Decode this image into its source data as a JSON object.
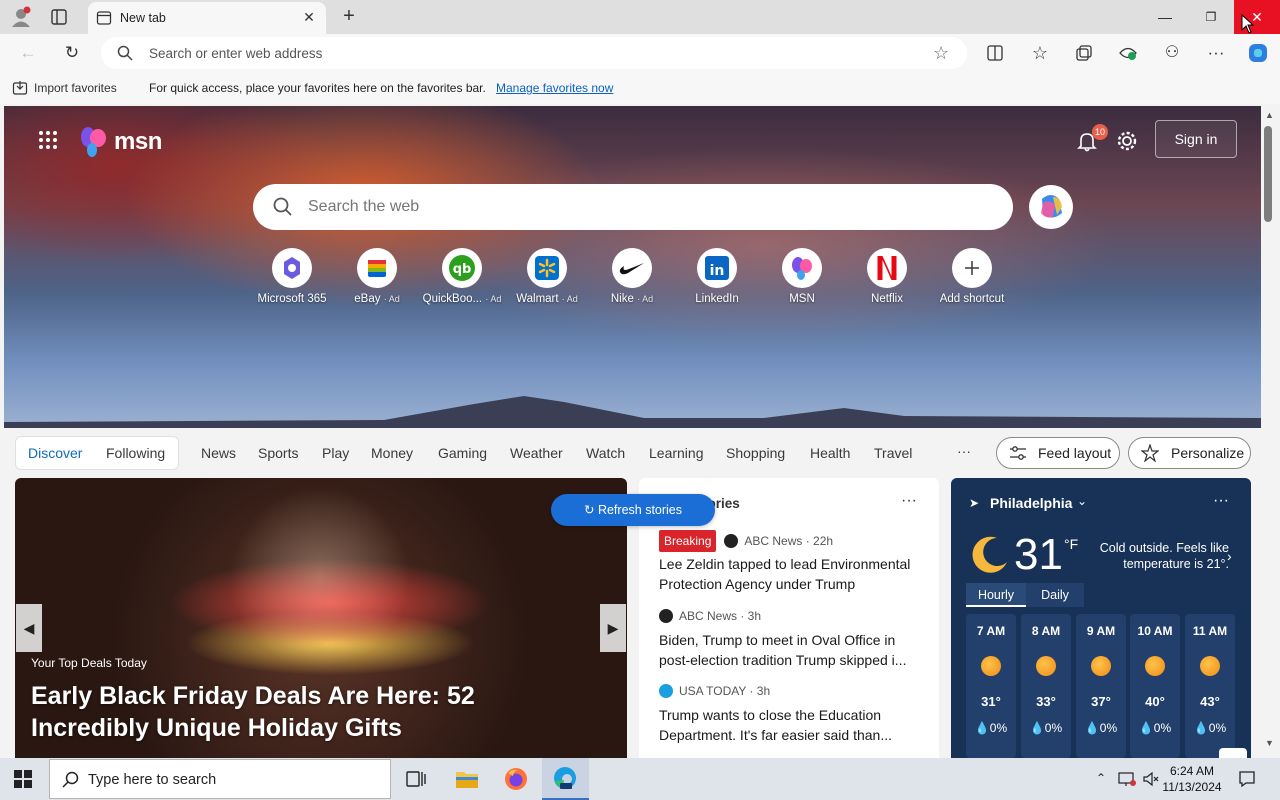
{
  "browser": {
    "tab_title": "New tab",
    "address_placeholder": "Search or enter web address",
    "favorites": {
      "import_label": "Import favorites",
      "message": "For quick access, place your favorites here on the favorites bar.",
      "manage_link": "Manage favorites now"
    }
  },
  "msn": {
    "logo_text": "msn",
    "notification_count": "10",
    "sign_in": "Sign in",
    "search_placeholder": "Search the web",
    "shortcuts": [
      {
        "label": "Microsoft 365",
        "ad": "",
        "icon": "microsoft365-icon"
      },
      {
        "label": "eBay",
        "ad": "· Ad",
        "icon": "ebay-icon"
      },
      {
        "label": "QuickBoo...",
        "ad": "· Ad",
        "icon": "quickbooks-icon"
      },
      {
        "label": "Walmart",
        "ad": "· Ad",
        "icon": "walmart-icon"
      },
      {
        "label": "Nike",
        "ad": "· Ad",
        "icon": "nike-icon"
      },
      {
        "label": "LinkedIn",
        "ad": "",
        "icon": "linkedin-icon"
      },
      {
        "label": "MSN",
        "ad": "",
        "icon": "msn-icon"
      },
      {
        "label": "Netflix",
        "ad": "",
        "icon": "netflix-icon"
      },
      {
        "label": "Add shortcut",
        "ad": "",
        "icon": "plus-icon"
      }
    ]
  },
  "feed_nav": {
    "discover": "Discover",
    "following": "Following",
    "items": [
      "News",
      "Sports",
      "Play",
      "Money",
      "Gaming",
      "Weather",
      "Watch",
      "Learning",
      "Shopping",
      "Health",
      "Travel"
    ],
    "more": "···",
    "feed_layout": "Feed layout",
    "personalize": "Personalize"
  },
  "hero_card": {
    "source": "Your Top Deals Today",
    "title": "Early Black Friday Deals Are Here: 52 Incredibly Unique Holiday Gifts"
  },
  "top_stories": {
    "header": "tories",
    "refresh": "Refresh stories",
    "stories": [
      {
        "badge": "Breaking",
        "source": "ABC News · 22h",
        "headline": "Lee Zeldin tapped to lead Environmental Protection Agency under Trump"
      },
      {
        "badge": "",
        "source": "ABC News · 3h",
        "headline": "Biden, Trump to meet in Oval Office in post-election tradition Trump skipped i..."
      },
      {
        "badge": "",
        "source": "USA TODAY · 3h",
        "headline": "Trump wants to close the Education Department. It's far easier said than..."
      }
    ]
  },
  "weather": {
    "city": "Philadelphia",
    "temp": "31",
    "unit": "°F",
    "condition": "Cold outside. Feels like temperature is 21°.",
    "tab_hourly": "Hourly",
    "tab_daily": "Daily",
    "hours": [
      {
        "time": "7 AM",
        "temp": "31°",
        "precip": "0%"
      },
      {
        "time": "8 AM",
        "temp": "33°",
        "precip": "0%"
      },
      {
        "time": "9 AM",
        "temp": "37°",
        "precip": "0%"
      },
      {
        "time": "10 AM",
        "temp": "40°",
        "precip": "0%"
      },
      {
        "time": "11 AM",
        "temp": "43°",
        "precip": "0%"
      }
    ]
  },
  "taskbar": {
    "search_placeholder": "Type here to search",
    "time": "6:24 AM",
    "date": "11/13/2024"
  }
}
